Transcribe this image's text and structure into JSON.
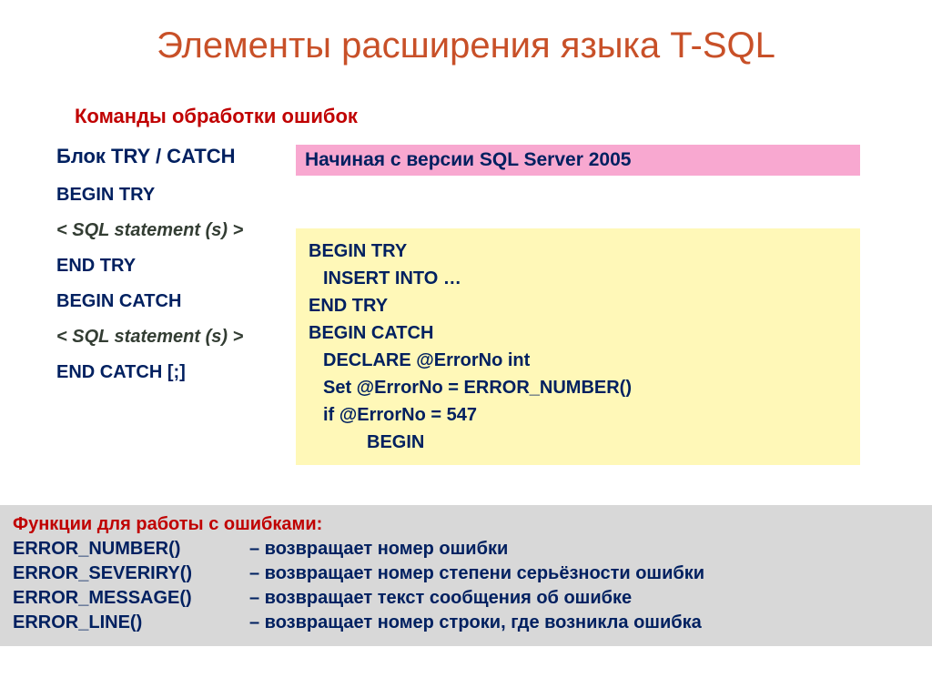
{
  "title": "Элементы расширения языка T-SQL",
  "subtitle": "Команды обработки ошибок",
  "left": {
    "block_title": "Блок TRY / CATCH",
    "begin_try": "BEGIN TRY",
    "sql_stmt1": " < SQL statement (s)  >",
    "end_try": "END TRY",
    "begin_catch": "BEGIN CATCH",
    "sql_stmt2": "< SQL statement (s) >",
    "end_catch": " END CATCH [;]"
  },
  "pink": "Начиная с версии SQL Server 2005",
  "yellow": {
    "l1": "BEGIN TRY",
    "l2": "INSERT INTO …",
    "l3": "END TRY",
    "l4": "BEGIN CATCH",
    "l5": "DECLARE @ErrorNo int",
    "l6": "Set @ErrorNo = ERROR_NUMBER()",
    "l7": "if @ErrorNo = 547",
    "l8": "BEGIN"
  },
  "gray": {
    "title": "Функции для работы с ошибками:",
    "rows": [
      {
        "name": "ERROR_NUMBER()",
        "desc": "– возвращает номер ошибки"
      },
      {
        "name": "ERROR_SEVERIRY()",
        "desc": "– возвращает номер степени серьёзности ошибки"
      },
      {
        "name": "ERROR_MESSAGE()",
        "desc": "– возвращает текст сообщения об ошибке"
      },
      {
        "name": "ERROR_LINE()",
        "desc": "– возвращает номер строки, где возникла ошибка"
      }
    ]
  }
}
